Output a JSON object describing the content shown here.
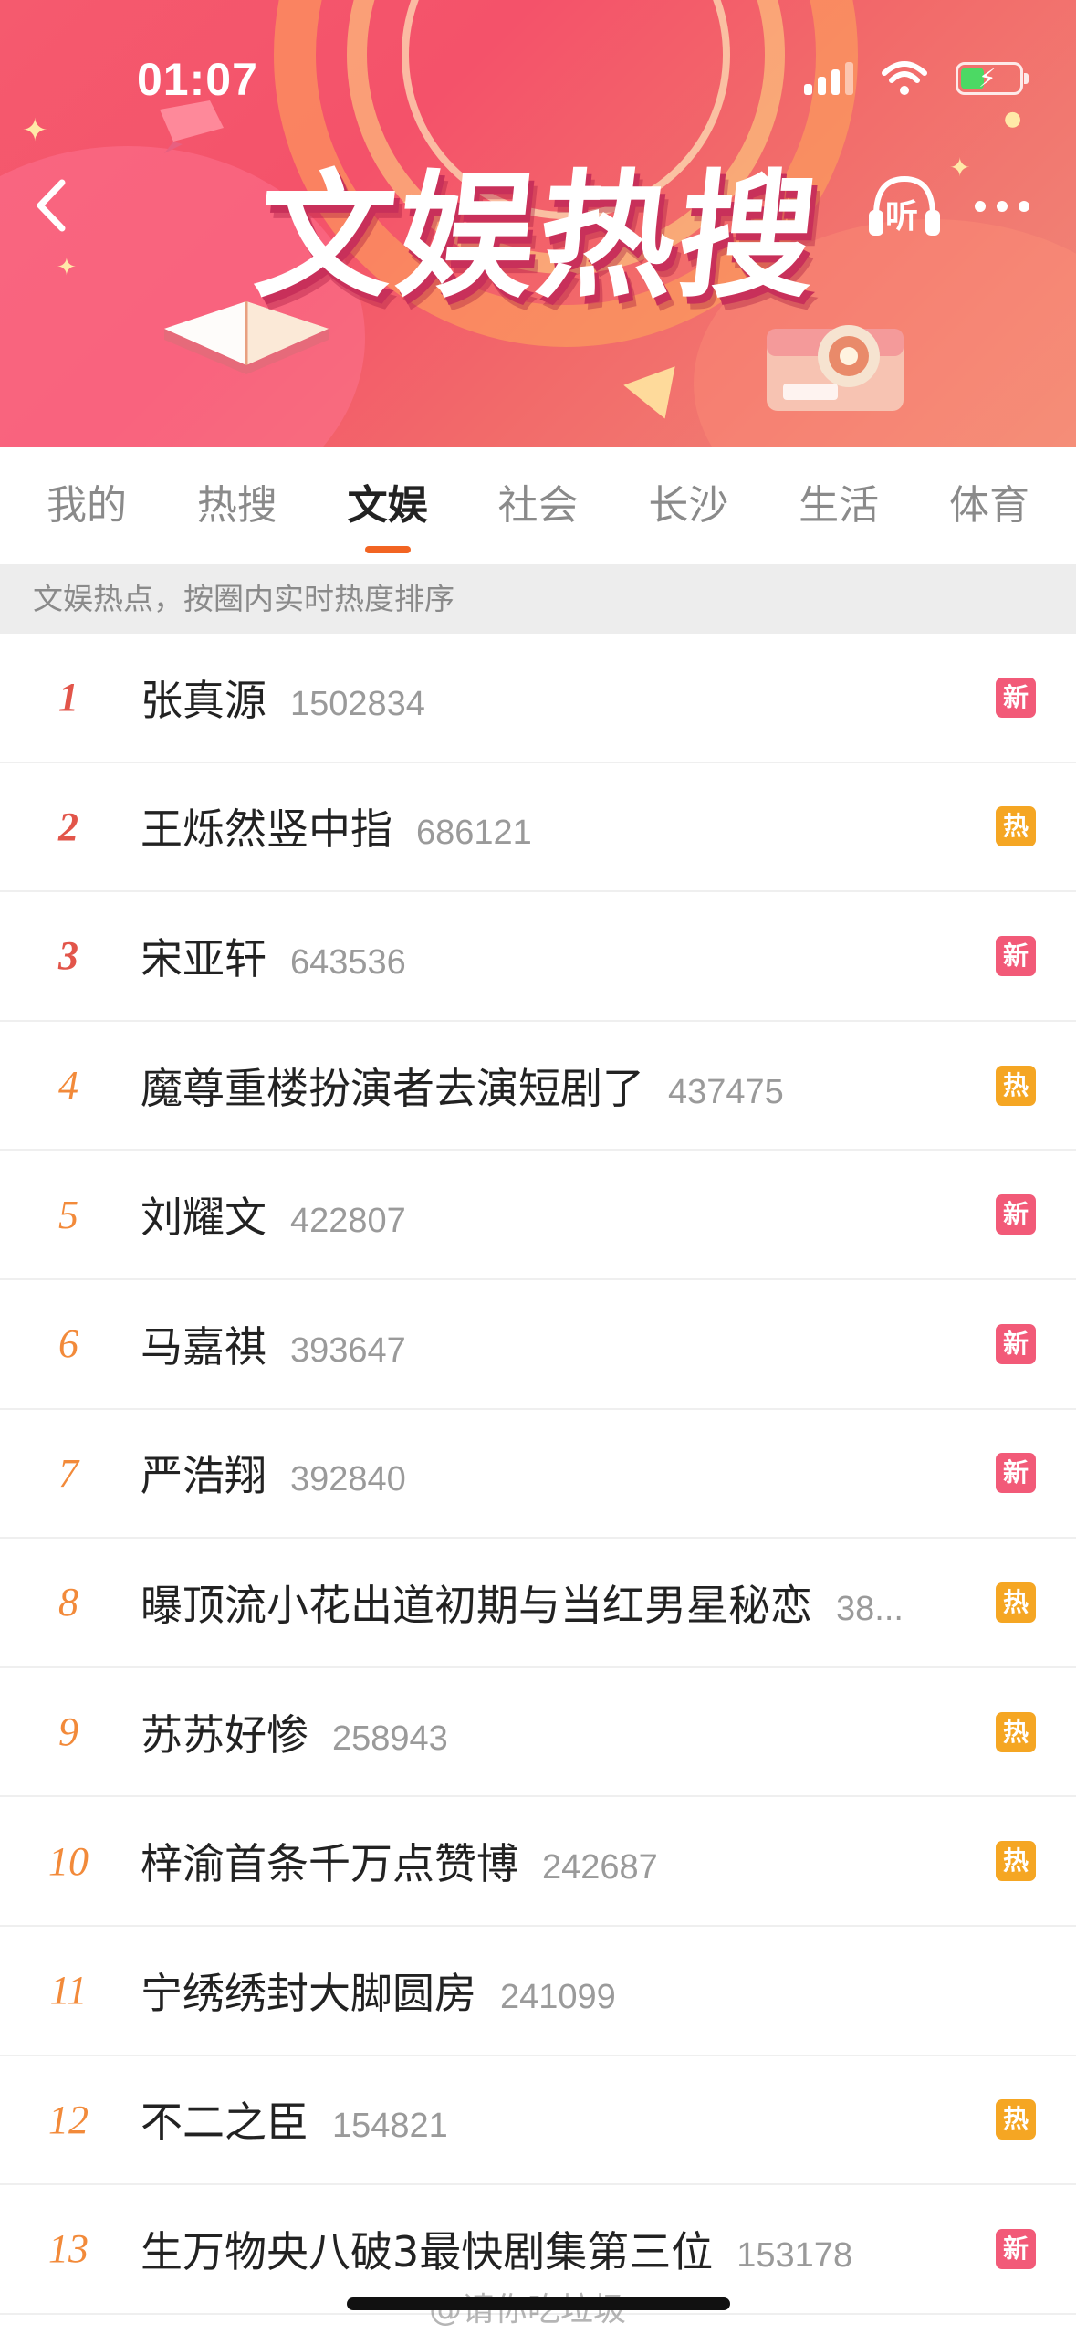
{
  "status_bar": {
    "time": "01:07"
  },
  "banner": {
    "title": "文娱热搜",
    "listen_label": "听"
  },
  "tabs": [
    {
      "label": "我的",
      "active": false
    },
    {
      "label": "热搜",
      "active": false
    },
    {
      "label": "文娱",
      "active": true
    },
    {
      "label": "社会",
      "active": false
    },
    {
      "label": "长沙",
      "active": false
    },
    {
      "label": "生活",
      "active": false
    },
    {
      "label": "体育",
      "active": false
    }
  ],
  "notice": "文娱热点，按圈内实时热度排序",
  "items": [
    {
      "rank": "1",
      "title": "张真源",
      "count": "1502834",
      "badge": "新",
      "badge_type": "new"
    },
    {
      "rank": "2",
      "title": "王烁然竖中指",
      "count": "686121",
      "badge": "热",
      "badge_type": "hot"
    },
    {
      "rank": "3",
      "title": "宋亚轩",
      "count": "643536",
      "badge": "新",
      "badge_type": "new"
    },
    {
      "rank": "4",
      "title": "魔尊重楼扮演者去演短剧了",
      "count": "437475",
      "badge": "热",
      "badge_type": "hot"
    },
    {
      "rank": "5",
      "title": "刘耀文",
      "count": "422807",
      "badge": "新",
      "badge_type": "new"
    },
    {
      "rank": "6",
      "title": "马嘉祺",
      "count": "393647",
      "badge": "新",
      "badge_type": "new"
    },
    {
      "rank": "7",
      "title": "严浩翔",
      "count": "392840",
      "badge": "新",
      "badge_type": "new"
    },
    {
      "rank": "8",
      "title": "曝顶流小花出道初期与当红男星秘恋",
      "count": "38...",
      "badge": "热",
      "badge_type": "hot"
    },
    {
      "rank": "9",
      "title": "苏苏好惨",
      "count": "258943",
      "badge": "热",
      "badge_type": "hot"
    },
    {
      "rank": "10",
      "title": "梓渝首条千万点赞博",
      "count": "242687",
      "badge": "热",
      "badge_type": "hot"
    },
    {
      "rank": "11",
      "title": "宁绣绣封大脚圆房",
      "count": "241099",
      "badge": "",
      "badge_type": ""
    },
    {
      "rank": "12",
      "title": "不二之臣",
      "count": "154821",
      "badge": "热",
      "badge_type": "hot"
    },
    {
      "rank": "13",
      "title": "生万物央八破3最快剧集第三位",
      "count": "153178",
      "badge": "新",
      "badge_type": "new"
    }
  ],
  "watermark": "@请你吃垃圾",
  "colors": {
    "accent": "#f26422",
    "badge_new": "#f25a78",
    "badge_hot": "#f5a623",
    "rank_top": "#e2554a",
    "rank": "#f28a3a"
  }
}
